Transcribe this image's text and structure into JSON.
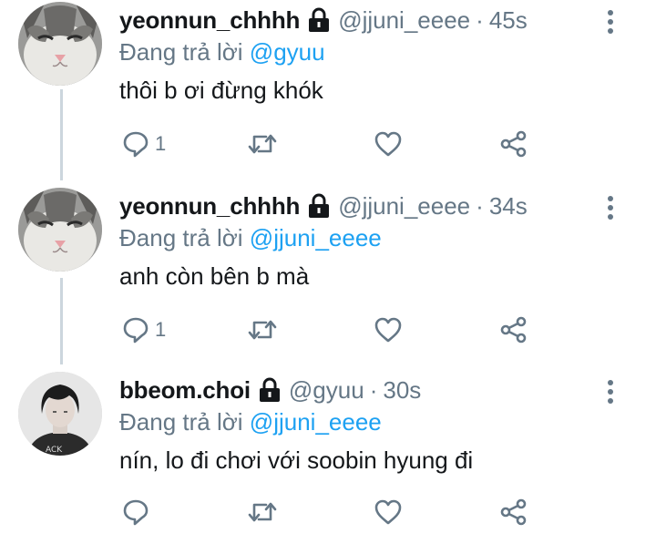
{
  "tweets": [
    {
      "display_name": "yeonnun_chhhh",
      "handle": "@jjuni_eeee",
      "separator": "·",
      "time": "45s",
      "replying_prefix": "Đang trả lời",
      "replying_to": "@gyuu",
      "text": "thôi b ơi đừng khók",
      "reply_count": "1",
      "avatar": "cat-avatar"
    },
    {
      "display_name": "yeonnun_chhhh",
      "handle": "@jjuni_eeee",
      "separator": "·",
      "time": "34s",
      "replying_prefix": "Đang trả lời",
      "replying_to": "@jjuni_eeee",
      "text": "anh còn bên b mà",
      "reply_count": "1",
      "avatar": "cat-avatar"
    },
    {
      "display_name": "bbeom.choi",
      "handle": "@gyuu",
      "separator": "·",
      "time": "30s",
      "replying_prefix": "Đang trả lời",
      "replying_to": "@jjuni_eeee",
      "text": "nín, lo đi chơi với soobin hyung đi",
      "reply_count": "",
      "avatar": "person-avatar"
    }
  ],
  "colors": {
    "primary_text": "#14171a",
    "secondary_text": "#657786",
    "mention": "#1da1f2",
    "thread_line": "#ccd6dd"
  },
  "icons": [
    "lock-icon",
    "more-vertical-icon",
    "reply-icon",
    "retweet-icon",
    "like-icon",
    "share-icon"
  ]
}
